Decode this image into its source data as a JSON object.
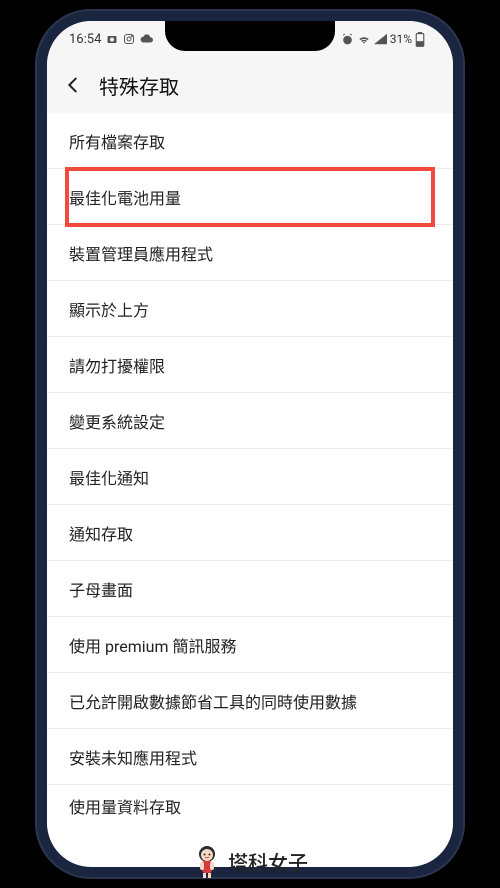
{
  "status_bar": {
    "time": "16:54",
    "battery_percent": "31%"
  },
  "header": {
    "title": "特殊存取"
  },
  "list": {
    "items": [
      {
        "label": "所有檔案存取",
        "highlighted": false
      },
      {
        "label": "最佳化電池用量",
        "highlighted": true
      },
      {
        "label": "裝置管理員應用程式",
        "highlighted": false
      },
      {
        "label": "顯示於上方",
        "highlighted": false
      },
      {
        "label": "請勿打擾權限",
        "highlighted": false
      },
      {
        "label": "變更系統設定",
        "highlighted": false
      },
      {
        "label": "最佳化通知",
        "highlighted": false
      },
      {
        "label": "通知存取",
        "highlighted": false
      },
      {
        "label": "子母畫面",
        "highlighted": false
      },
      {
        "label": "使用 premium 簡訊服務",
        "highlighted": false
      },
      {
        "label": "已允許開啟數據節省工具的同時使用數據",
        "highlighted": false
      },
      {
        "label": "安裝未知應用程式",
        "highlighted": false
      },
      {
        "label": "使用量資料存取",
        "highlighted": false
      }
    ]
  },
  "watermark": {
    "text": "塔科女子"
  },
  "colors": {
    "highlight": "#f24a3d",
    "screen_bg": "#ffffff",
    "header_bg": "#f6f6f6"
  }
}
